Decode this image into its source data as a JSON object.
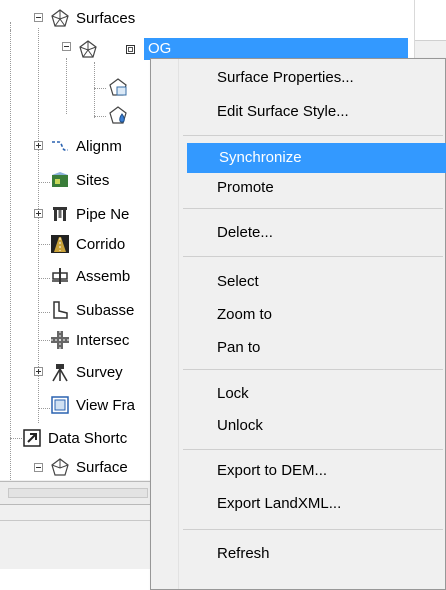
{
  "tree": {
    "items": [
      {
        "label": "Surfaces",
        "icon": "surfaces-icon"
      },
      {
        "label": "OG",
        "icon": "surface-icon"
      },
      {
        "label": "",
        "icon": "surface-definition-icon"
      },
      {
        "label": "",
        "icon": "surface-watershed-icon"
      },
      {
        "label": "Alignm",
        "icon": "alignment-icon"
      },
      {
        "label": "Sites",
        "icon": "sites-icon"
      },
      {
        "label": "Pipe Ne",
        "icon": "pipe-network-icon"
      },
      {
        "label": "Corrido",
        "icon": "corridor-icon"
      },
      {
        "label": "Assemb",
        "icon": "assembly-icon"
      },
      {
        "label": "Subasse",
        "icon": "subassembly-icon"
      },
      {
        "label": "Intersec",
        "icon": "intersection-icon"
      },
      {
        "label": "Survey",
        "icon": "survey-icon"
      },
      {
        "label": "View Fra",
        "icon": "view-frame-icon"
      },
      {
        "label": "Data Shortc",
        "icon": "data-shortcuts-icon"
      },
      {
        "label": "Surface",
        "icon": "surfaces-icon"
      }
    ]
  },
  "context_menu": {
    "groups": [
      {
        "items": [
          {
            "label": "Surface Properties...",
            "highlighted": false
          },
          {
            "label": "Edit Surface Style...",
            "highlighted": false
          }
        ]
      },
      {
        "items": [
          {
            "label": "Synchronize",
            "highlighted": true
          },
          {
            "label": "Promote",
            "highlighted": false
          }
        ]
      },
      {
        "items": [
          {
            "label": "Delete...",
            "highlighted": false
          }
        ]
      },
      {
        "items": [
          {
            "label": "Select",
            "highlighted": false
          },
          {
            "label": "Zoom to",
            "highlighted": false
          },
          {
            "label": "Pan to",
            "highlighted": false
          }
        ]
      },
      {
        "items": [
          {
            "label": "Lock",
            "highlighted": false
          },
          {
            "label": "Unlock",
            "highlighted": false
          }
        ]
      },
      {
        "items": [
          {
            "label": "Export to DEM...",
            "highlighted": false
          },
          {
            "label": "Export LandXML...",
            "highlighted": false
          }
        ]
      },
      {
        "items": [
          {
            "label": "Refresh",
            "highlighted": false
          }
        ]
      }
    ]
  },
  "colors": {
    "selection": "#3399ff",
    "menu_bg": "#f0f0f0",
    "separator": "#cfcfcf"
  }
}
